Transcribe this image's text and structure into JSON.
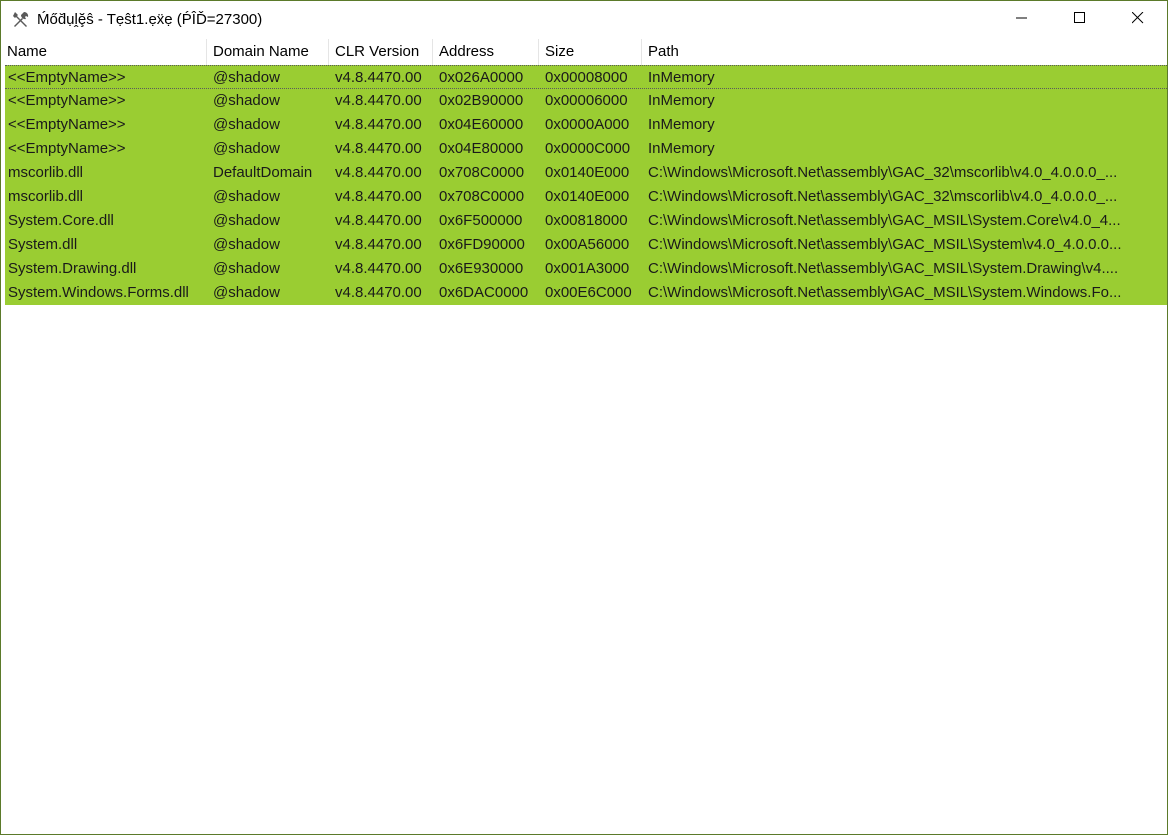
{
  "window": {
    "title": "Ḿőd̆ụḽḝŝ - Tẹŝt1.ẹẍẹ (ṔÎĎ=27300)",
    "icon": "tools-icon",
    "minimize_icon": "minimize-icon",
    "maximize_icon": "maximize-icon",
    "close_icon": "close-icon"
  },
  "table": {
    "row_color": "#9acd32",
    "columns": [
      "Name",
      "Domain Name",
      "CLR Version",
      "Address",
      "Size",
      "Path"
    ],
    "rows": [
      [
        "<<EmptyName>>",
        "@shadow",
        "v4.8.4470.00",
        "0x026A0000",
        "0x00008000",
        "InMemory"
      ],
      [
        "<<EmptyName>>",
        "@shadow",
        "v4.8.4470.00",
        "0x02B90000",
        "0x00006000",
        "InMemory"
      ],
      [
        "<<EmptyName>>",
        "@shadow",
        "v4.8.4470.00",
        "0x04E60000",
        "0x0000A000",
        "InMemory"
      ],
      [
        "<<EmptyName>>",
        "@shadow",
        "v4.8.4470.00",
        "0x04E80000",
        "0x0000C000",
        "InMemory"
      ],
      [
        "mscorlib.dll",
        "DefaultDomain",
        "v4.8.4470.00",
        "0x708C0000",
        "0x0140E000",
        "C:\\Windows\\Microsoft.Net\\assembly\\GAC_32\\mscorlib\\v4.0_4.0.0.0_..."
      ],
      [
        "mscorlib.dll",
        "@shadow",
        "v4.8.4470.00",
        "0x708C0000",
        "0x0140E000",
        "C:\\Windows\\Microsoft.Net\\assembly\\GAC_32\\mscorlib\\v4.0_4.0.0.0_..."
      ],
      [
        "System.Core.dll",
        "@shadow",
        "v4.8.4470.00",
        "0x6F500000",
        "0x00818000",
        "C:\\Windows\\Microsoft.Net\\assembly\\GAC_MSIL\\System.Core\\v4.0_4..."
      ],
      [
        "System.dll",
        "@shadow",
        "v4.8.4470.00",
        "0x6FD90000",
        "0x00A56000",
        "C:\\Windows\\Microsoft.Net\\assembly\\GAC_MSIL\\System\\v4.0_4.0.0.0..."
      ],
      [
        "System.Drawing.dll",
        "@shadow",
        "v4.8.4470.00",
        "0x6E930000",
        "0x001A3000",
        "C:\\Windows\\Microsoft.Net\\assembly\\GAC_MSIL\\System.Drawing\\v4...."
      ],
      [
        "System.Windows.Forms.dll",
        "@shadow",
        "v4.8.4470.00",
        "0x6DAC0000",
        "0x00E6C000",
        "C:\\Windows\\Microsoft.Net\\assembly\\GAC_MSIL\\System.Windows.Fo..."
      ]
    ]
  }
}
